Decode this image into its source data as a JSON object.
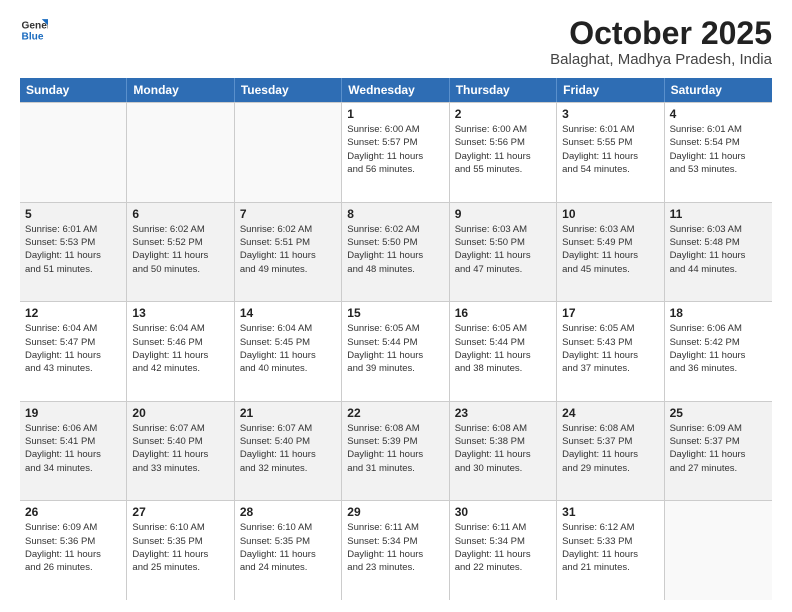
{
  "logo": {
    "general": "General",
    "blue": "Blue"
  },
  "title": "October 2025",
  "location": "Balaghat, Madhya Pradesh, India",
  "header_days": [
    "Sunday",
    "Monday",
    "Tuesday",
    "Wednesday",
    "Thursday",
    "Friday",
    "Saturday"
  ],
  "weeks": [
    [
      {
        "day": "",
        "info": ""
      },
      {
        "day": "",
        "info": ""
      },
      {
        "day": "",
        "info": ""
      },
      {
        "day": "1",
        "info": "Sunrise: 6:00 AM\nSunset: 5:57 PM\nDaylight: 11 hours\nand 56 minutes."
      },
      {
        "day": "2",
        "info": "Sunrise: 6:00 AM\nSunset: 5:56 PM\nDaylight: 11 hours\nand 55 minutes."
      },
      {
        "day": "3",
        "info": "Sunrise: 6:01 AM\nSunset: 5:55 PM\nDaylight: 11 hours\nand 54 minutes."
      },
      {
        "day": "4",
        "info": "Sunrise: 6:01 AM\nSunset: 5:54 PM\nDaylight: 11 hours\nand 53 minutes."
      }
    ],
    [
      {
        "day": "5",
        "info": "Sunrise: 6:01 AM\nSunset: 5:53 PM\nDaylight: 11 hours\nand 51 minutes."
      },
      {
        "day": "6",
        "info": "Sunrise: 6:02 AM\nSunset: 5:52 PM\nDaylight: 11 hours\nand 50 minutes."
      },
      {
        "day": "7",
        "info": "Sunrise: 6:02 AM\nSunset: 5:51 PM\nDaylight: 11 hours\nand 49 minutes."
      },
      {
        "day": "8",
        "info": "Sunrise: 6:02 AM\nSunset: 5:50 PM\nDaylight: 11 hours\nand 48 minutes."
      },
      {
        "day": "9",
        "info": "Sunrise: 6:03 AM\nSunset: 5:50 PM\nDaylight: 11 hours\nand 47 minutes."
      },
      {
        "day": "10",
        "info": "Sunrise: 6:03 AM\nSunset: 5:49 PM\nDaylight: 11 hours\nand 45 minutes."
      },
      {
        "day": "11",
        "info": "Sunrise: 6:03 AM\nSunset: 5:48 PM\nDaylight: 11 hours\nand 44 minutes."
      }
    ],
    [
      {
        "day": "12",
        "info": "Sunrise: 6:04 AM\nSunset: 5:47 PM\nDaylight: 11 hours\nand 43 minutes."
      },
      {
        "day": "13",
        "info": "Sunrise: 6:04 AM\nSunset: 5:46 PM\nDaylight: 11 hours\nand 42 minutes."
      },
      {
        "day": "14",
        "info": "Sunrise: 6:04 AM\nSunset: 5:45 PM\nDaylight: 11 hours\nand 40 minutes."
      },
      {
        "day": "15",
        "info": "Sunrise: 6:05 AM\nSunset: 5:44 PM\nDaylight: 11 hours\nand 39 minutes."
      },
      {
        "day": "16",
        "info": "Sunrise: 6:05 AM\nSunset: 5:44 PM\nDaylight: 11 hours\nand 38 minutes."
      },
      {
        "day": "17",
        "info": "Sunrise: 6:05 AM\nSunset: 5:43 PM\nDaylight: 11 hours\nand 37 minutes."
      },
      {
        "day": "18",
        "info": "Sunrise: 6:06 AM\nSunset: 5:42 PM\nDaylight: 11 hours\nand 36 minutes."
      }
    ],
    [
      {
        "day": "19",
        "info": "Sunrise: 6:06 AM\nSunset: 5:41 PM\nDaylight: 11 hours\nand 34 minutes."
      },
      {
        "day": "20",
        "info": "Sunrise: 6:07 AM\nSunset: 5:40 PM\nDaylight: 11 hours\nand 33 minutes."
      },
      {
        "day": "21",
        "info": "Sunrise: 6:07 AM\nSunset: 5:40 PM\nDaylight: 11 hours\nand 32 minutes."
      },
      {
        "day": "22",
        "info": "Sunrise: 6:08 AM\nSunset: 5:39 PM\nDaylight: 11 hours\nand 31 minutes."
      },
      {
        "day": "23",
        "info": "Sunrise: 6:08 AM\nSunset: 5:38 PM\nDaylight: 11 hours\nand 30 minutes."
      },
      {
        "day": "24",
        "info": "Sunrise: 6:08 AM\nSunset: 5:37 PM\nDaylight: 11 hours\nand 29 minutes."
      },
      {
        "day": "25",
        "info": "Sunrise: 6:09 AM\nSunset: 5:37 PM\nDaylight: 11 hours\nand 27 minutes."
      }
    ],
    [
      {
        "day": "26",
        "info": "Sunrise: 6:09 AM\nSunset: 5:36 PM\nDaylight: 11 hours\nand 26 minutes."
      },
      {
        "day": "27",
        "info": "Sunrise: 6:10 AM\nSunset: 5:35 PM\nDaylight: 11 hours\nand 25 minutes."
      },
      {
        "day": "28",
        "info": "Sunrise: 6:10 AM\nSunset: 5:35 PM\nDaylight: 11 hours\nand 24 minutes."
      },
      {
        "day": "29",
        "info": "Sunrise: 6:11 AM\nSunset: 5:34 PM\nDaylight: 11 hours\nand 23 minutes."
      },
      {
        "day": "30",
        "info": "Sunrise: 6:11 AM\nSunset: 5:34 PM\nDaylight: 11 hours\nand 22 minutes."
      },
      {
        "day": "31",
        "info": "Sunrise: 6:12 AM\nSunset: 5:33 PM\nDaylight: 11 hours\nand 21 minutes."
      },
      {
        "day": "",
        "info": ""
      }
    ]
  ]
}
